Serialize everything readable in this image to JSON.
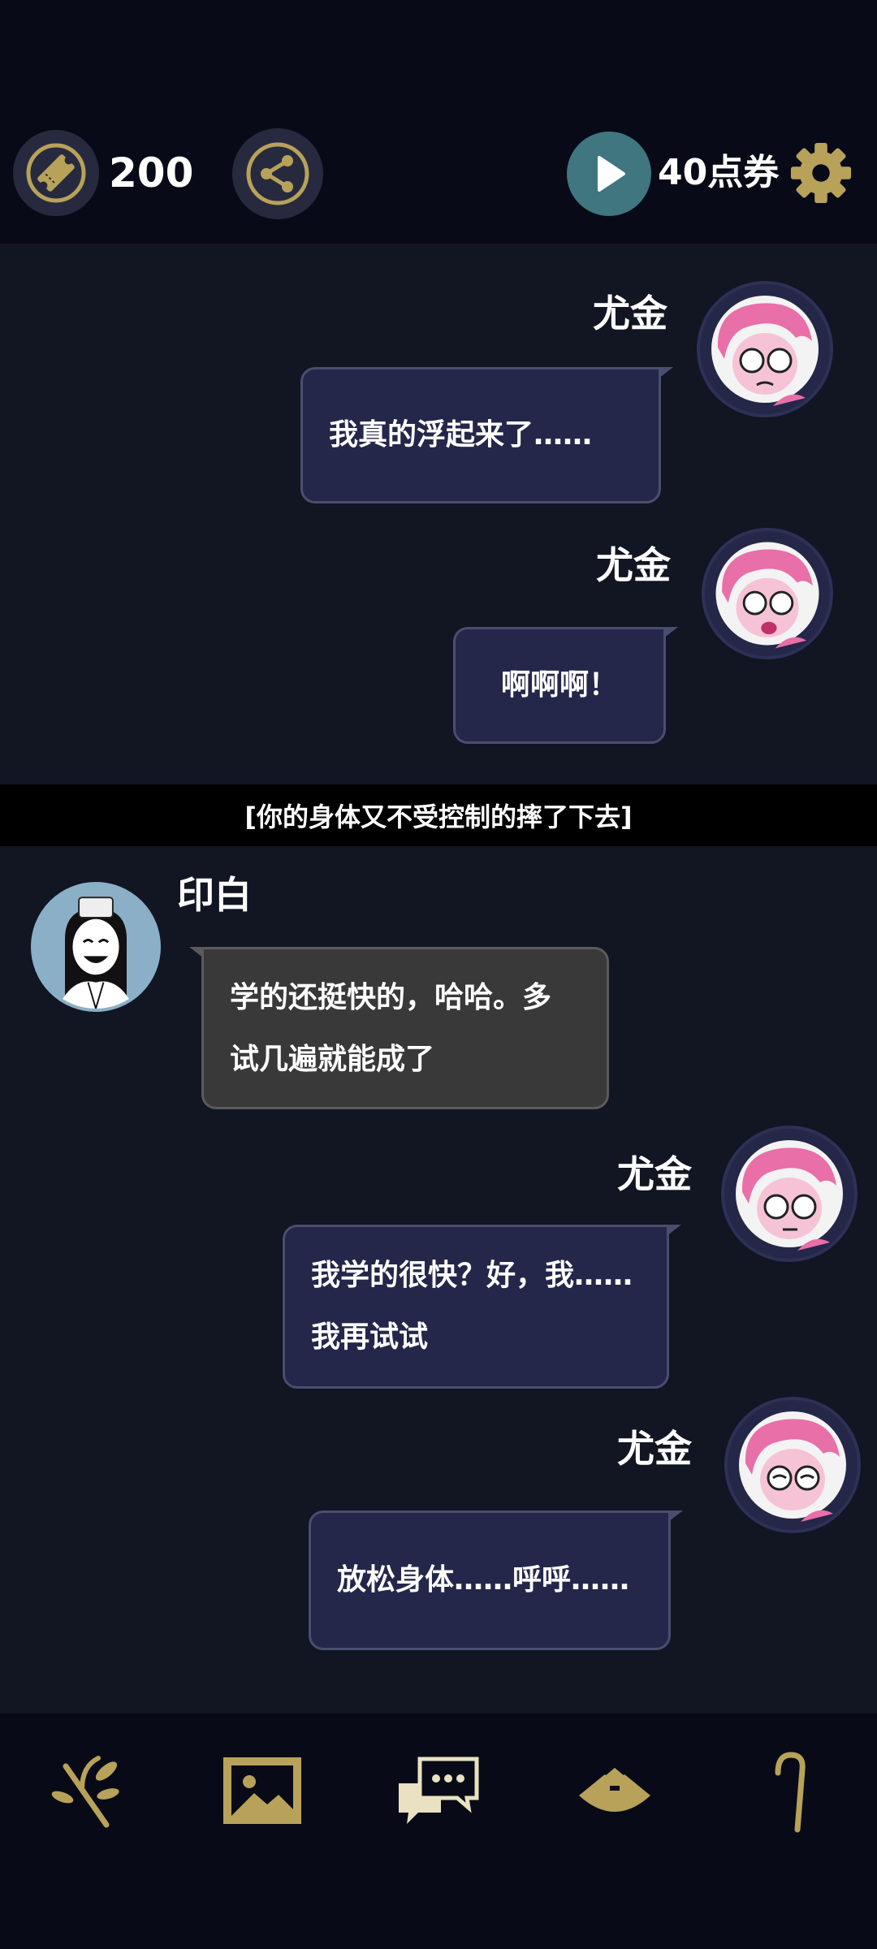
{
  "header": {
    "ticket_count": "200",
    "points_label": "40点券",
    "icons": [
      "ticket-icon",
      "share-icon",
      "play-icon",
      "gear-icon"
    ]
  },
  "messages": [
    {
      "speaker": "尤金",
      "text": "我真的浮起来了……",
      "side": "right"
    },
    {
      "speaker": "尤金",
      "text": "啊啊啊！",
      "side": "right"
    },
    {
      "speaker": "印白",
      "text_lines": [
        "学的还挺快的，哈哈。多",
        "试几遍就能成了"
      ],
      "side": "left"
    },
    {
      "speaker": "尤金",
      "text_lines": [
        "我学的很快？好，我……",
        "我再试试"
      ],
      "side": "right"
    },
    {
      "speaker": "尤金",
      "text": "放松身体……呼呼……",
      "side": "right"
    }
  ],
  "narration": "[你的身体又不受控制的摔了下去]",
  "bottom_nav": [
    "branch-icon",
    "gallery-icon",
    "chat-icon",
    "hat-icon",
    "cane-icon"
  ],
  "colors": {
    "accent_gold": "#b8a25a",
    "bubble_right": "#24274a",
    "bubble_left": "#393939",
    "play_button": "#3f7680"
  }
}
